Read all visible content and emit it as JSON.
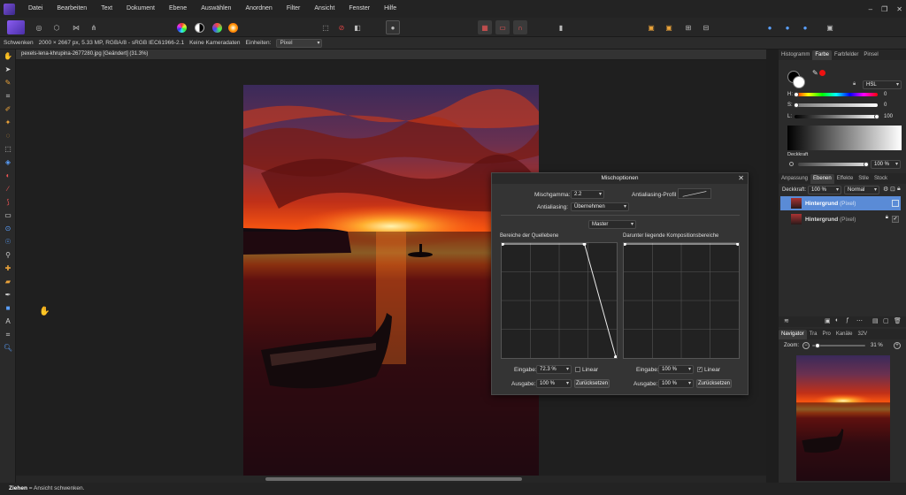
{
  "menu": {
    "items": [
      "Datei",
      "Bearbeiten",
      "Text",
      "Dokument",
      "Ebene",
      "Auswählen",
      "Anordnen",
      "Filter",
      "Ansicht",
      "Fenster",
      "Hilfe"
    ]
  },
  "context": {
    "tool": "Schwenken",
    "docinfo": "2000 × 2667 px, 5.33 MP, RGBA/8 - sRGB IEC61966-2.1",
    "camera": "Keine Kameradaten",
    "units_label": "Einheiten:",
    "units_value": "Pixel"
  },
  "document": {
    "tab_title": "pexels-lena-khrupina-2677280.jpg [Geändert] (31.3%)"
  },
  "status": {
    "bold": "Ziehen",
    "text": " = Ansicht schwenken."
  },
  "colorpanel": {
    "tabs": [
      "Histogramm",
      "Farbe",
      "Farbfelder",
      "Pinsel"
    ],
    "active_tab": "Farbe",
    "model": "HSL",
    "h_label": "H:",
    "h_value": "0",
    "s_label": "S:",
    "s_value": "0",
    "l_label": "L:",
    "l_value": "100",
    "opacity_label": "Deckkraft",
    "opacity_value": "100 %"
  },
  "layerspanel": {
    "tabs": [
      "Anpassung",
      "Ebenen",
      "Effekte",
      "Stile",
      "Stock"
    ],
    "active_tab": "Ebenen",
    "opacity_label": "Deckkraft:",
    "opacity_value": "100 %",
    "blend": "Normal",
    "layers": [
      {
        "name": "Hintergrund",
        "type": "(Pixel)"
      },
      {
        "name": "Hintergrund",
        "type": "(Pixel)"
      }
    ]
  },
  "navigator": {
    "tabs": [
      "Navigator",
      "Tra",
      "Pro",
      "Kanäle",
      "32V"
    ],
    "active_tab": "Navigator",
    "zoom_label": "Zoom:",
    "zoom_value": "31 %"
  },
  "dialog": {
    "title": "Mischoptionen",
    "gamma_label": "Mischgamma:",
    "gamma_value": "2.2",
    "aa_profile_label": "Antialiasing-Profil",
    "aa_label": "Antialiasing:",
    "aa_value": "Übernehmen",
    "channel": "Master",
    "source_title": "Bereiche der Quellebene",
    "under_title": "Darunter liegende Kompositionsbereiche",
    "left": {
      "input_label": "Eingabe:",
      "input_value": "72.3 %",
      "linear_label": "Linear",
      "linear_checked": false,
      "output_label": "Ausgabe:",
      "output_value": "100 %",
      "reset": "Zurücksetzen"
    },
    "right": {
      "input_label": "Eingabe:",
      "input_value": "100 %",
      "linear_label": "Linear",
      "linear_checked": true,
      "output_label": "Ausgabe:",
      "output_value": "100 %",
      "reset": "Zurücksetzen"
    }
  },
  "colors": {
    "accent": "#5a8bd6",
    "app_bg": "#1e1e1e",
    "panel_bg": "#2b2b2b"
  }
}
